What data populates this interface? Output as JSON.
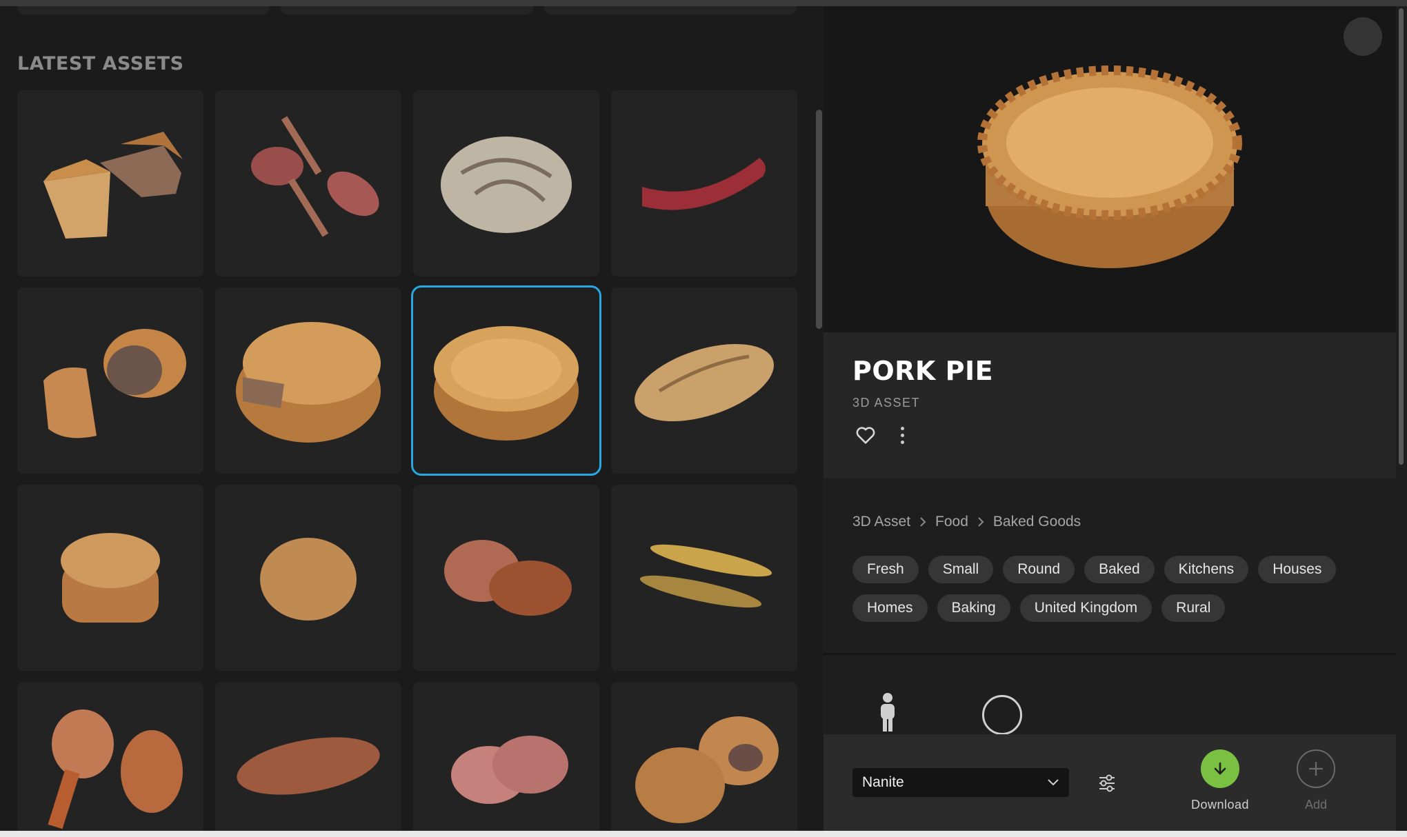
{
  "left_panel": {
    "section_title": "LATEST ASSETS",
    "assets": [
      {
        "icon": "pie-slice-icon"
      },
      {
        "icon": "ham-legs-icon"
      },
      {
        "icon": "bread-loaf-icon"
      },
      {
        "icon": "sausage-icon"
      },
      {
        "icon": "cut-pie-icon"
      },
      {
        "icon": "sliced-pie-icon"
      },
      {
        "icon": "pork-pie-icon",
        "selected": true
      },
      {
        "icon": "baguette-icon"
      },
      {
        "icon": "small-pie-icon"
      },
      {
        "icon": "dough-icon"
      },
      {
        "icon": "roast-meat-icon"
      },
      {
        "icon": "fish-icon"
      },
      {
        "icon": "drumstick-icon"
      },
      {
        "icon": "meat-cut-icon"
      },
      {
        "icon": "salami-slices-icon"
      },
      {
        "icon": "broken-pie-icon"
      }
    ]
  },
  "detail": {
    "title": "PORK PIE",
    "type": "3D ASSET",
    "breadcrumb": [
      "3D Asset",
      "Food",
      "Baked Goods"
    ],
    "tags": [
      "Fresh",
      "Small",
      "Round",
      "Baked",
      "Kitchens",
      "Houses",
      "Homes",
      "Baking",
      "United Kingdom",
      "Rural"
    ],
    "lod_selected": "Nanite",
    "download_label": "Download",
    "add_label": "Add"
  },
  "colors": {
    "accent_blue": "#2aa6e0",
    "download_green": "#79c043"
  }
}
